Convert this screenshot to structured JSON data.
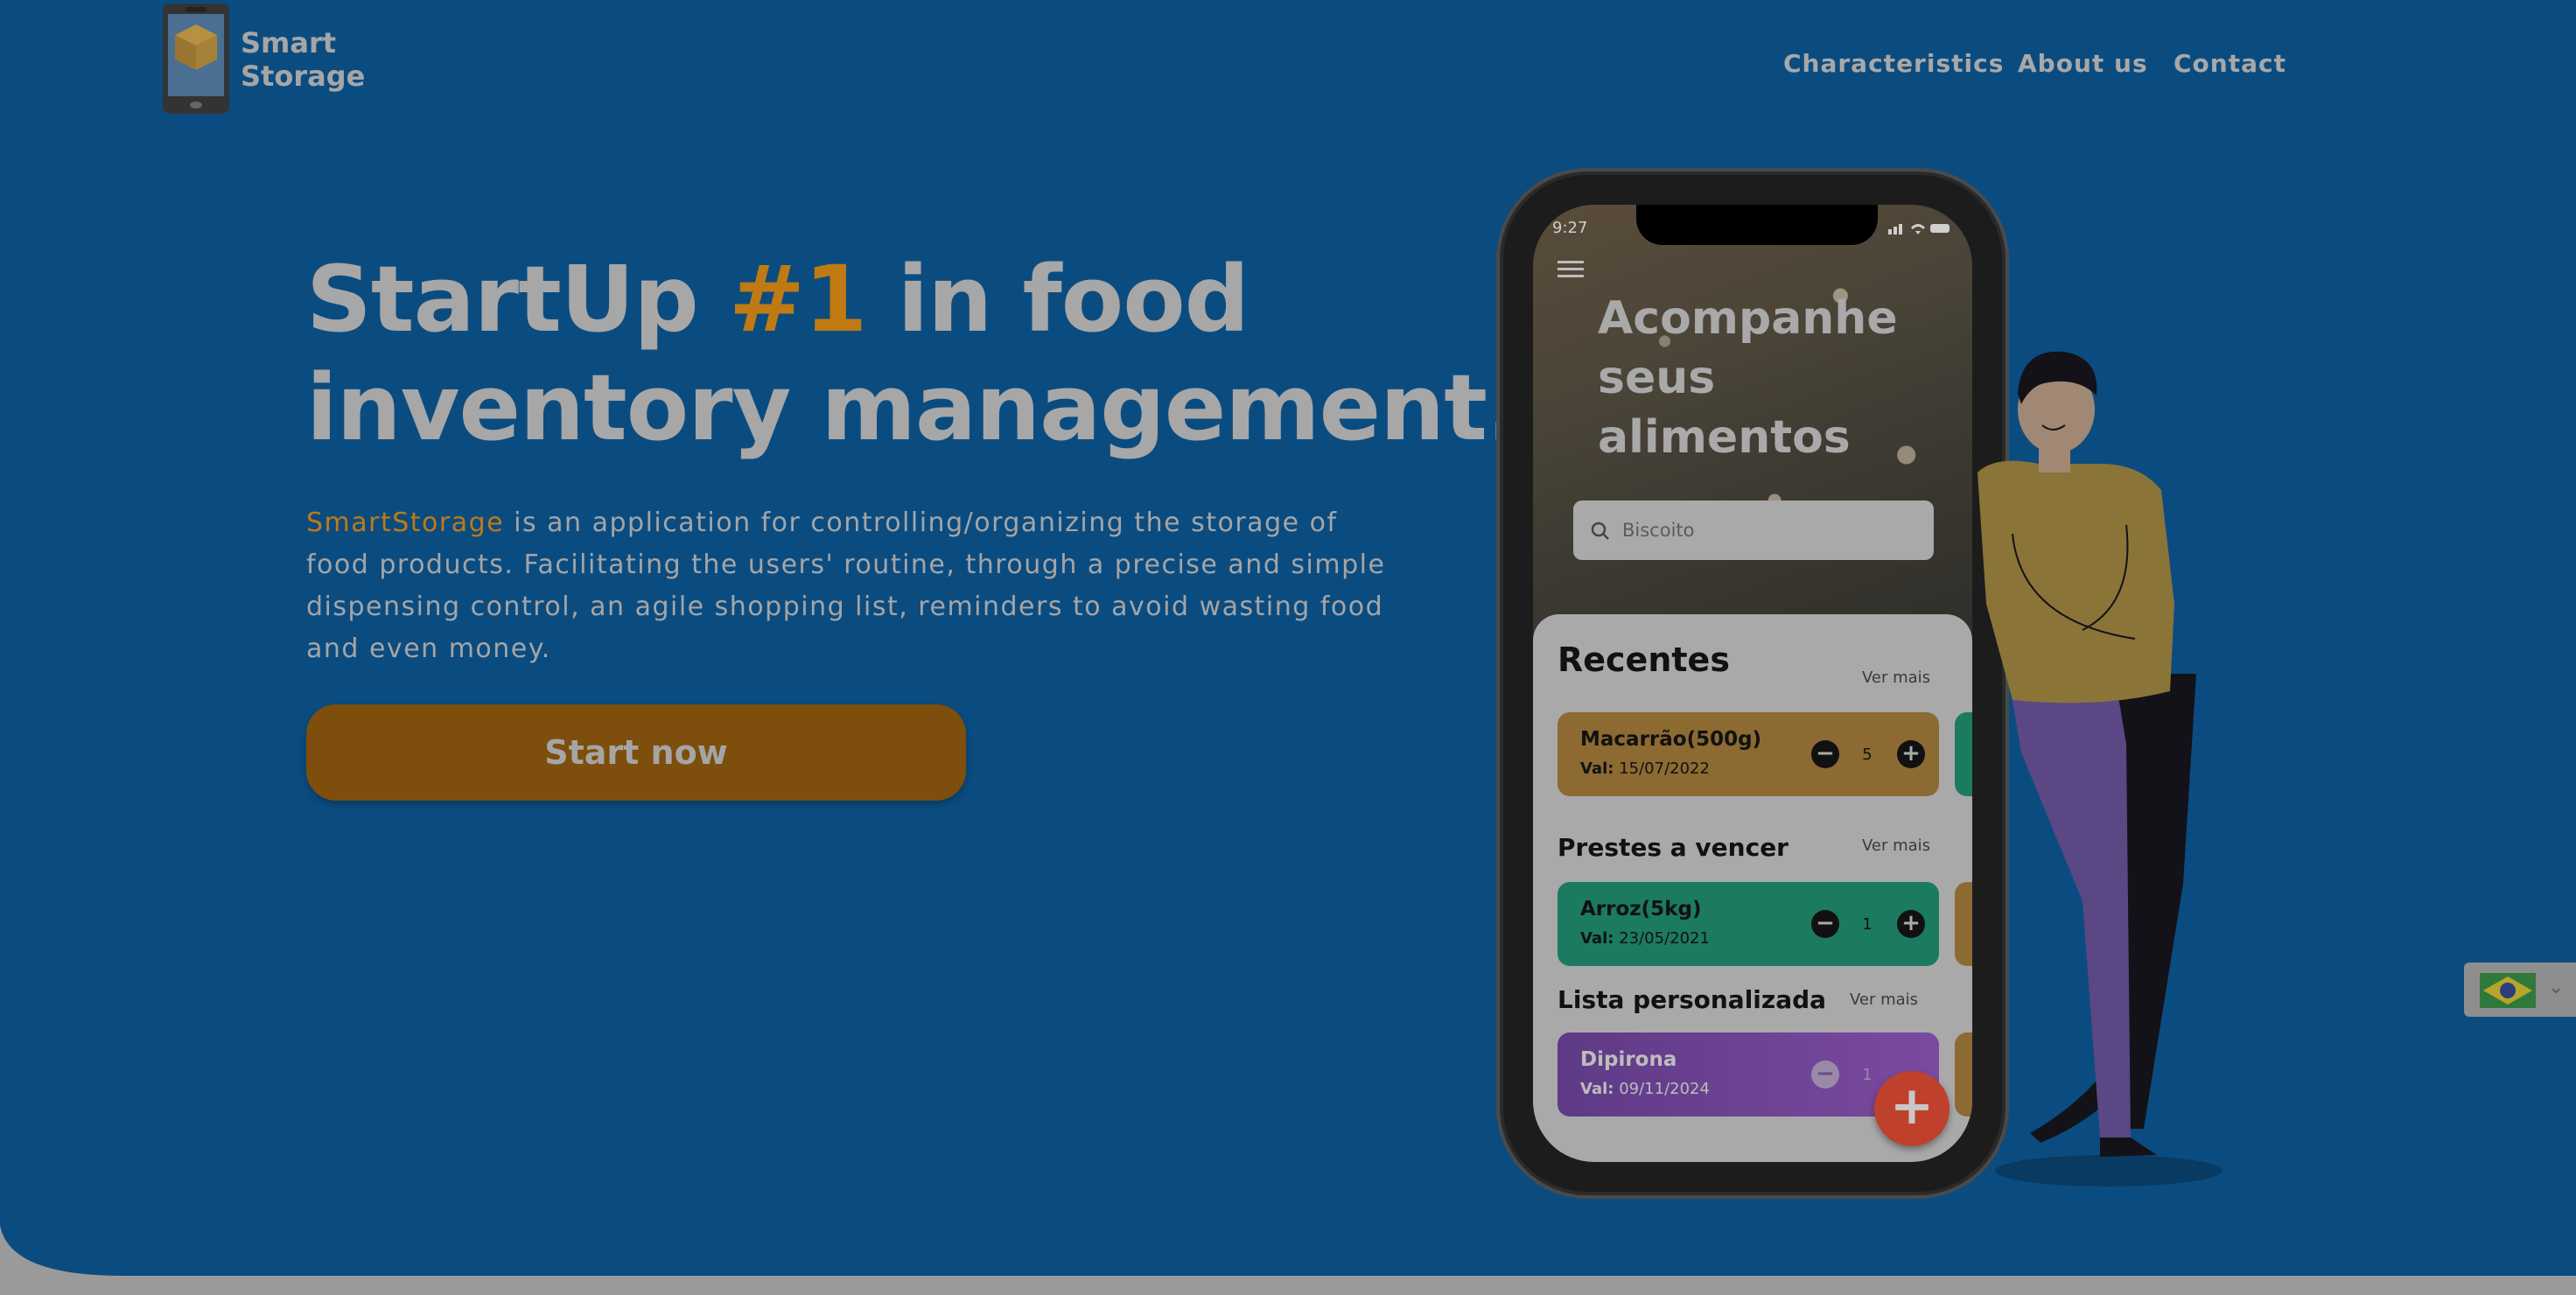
{
  "header": {
    "brand_line1": "Smart",
    "brand_line2": "Storage",
    "nav": [
      "Characteristics",
      "About us",
      "Contact"
    ]
  },
  "hero": {
    "headline_part1": "StartUp ",
    "headline_accent": "#1",
    "headline_part2": " in food",
    "headline_line2": "inventory management.",
    "desc_brand": "SmartStorage",
    "desc_rest": " is an application for controlling/organizing the storage of food products. Facilitating the users' routine, through a precise and simple dispensing control, an agile shopping list, reminders to avoid wasting food and even money.",
    "cta_label": "Start now"
  },
  "phone": {
    "status_time": "9:27",
    "title_lines": [
      "Acompanhe",
      "seus",
      "alimentos"
    ],
    "search_placeholder": "Biscoito",
    "see_more": "Ver mais",
    "sections": [
      {
        "title": "Recentes",
        "card": {
          "name": "Macarrão(500g)",
          "val_label": "Val:",
          "val": "15/07/2022",
          "qty": "5",
          "color": "#8c6a32",
          "peek_color": "#1b7a5f"
        }
      },
      {
        "title": "Prestes a vencer",
        "card": {
          "name": "Arroz(5kg)",
          "val_label": "Val:",
          "val": "23/05/2021",
          "qty": "1",
          "color": "#1b7a5f",
          "peek_color": "#8c6a32"
        }
      },
      {
        "title": "Lista personalizada",
        "card": {
          "name": "Dipirona",
          "val_label": "Val:",
          "val": "09/11/2024",
          "qty": "1",
          "color": "#6a3f8f",
          "peek_color": "#8c6a32"
        }
      }
    ],
    "fab_label": "+"
  },
  "language_selector": {
    "flag": "brazil-flag-icon",
    "caret": "⌄"
  },
  "colors": {
    "background": "#0b4c80",
    "accent": "#bf7a12",
    "cta": "#7d4e0c",
    "text_muted": "#a7a7a7"
  }
}
